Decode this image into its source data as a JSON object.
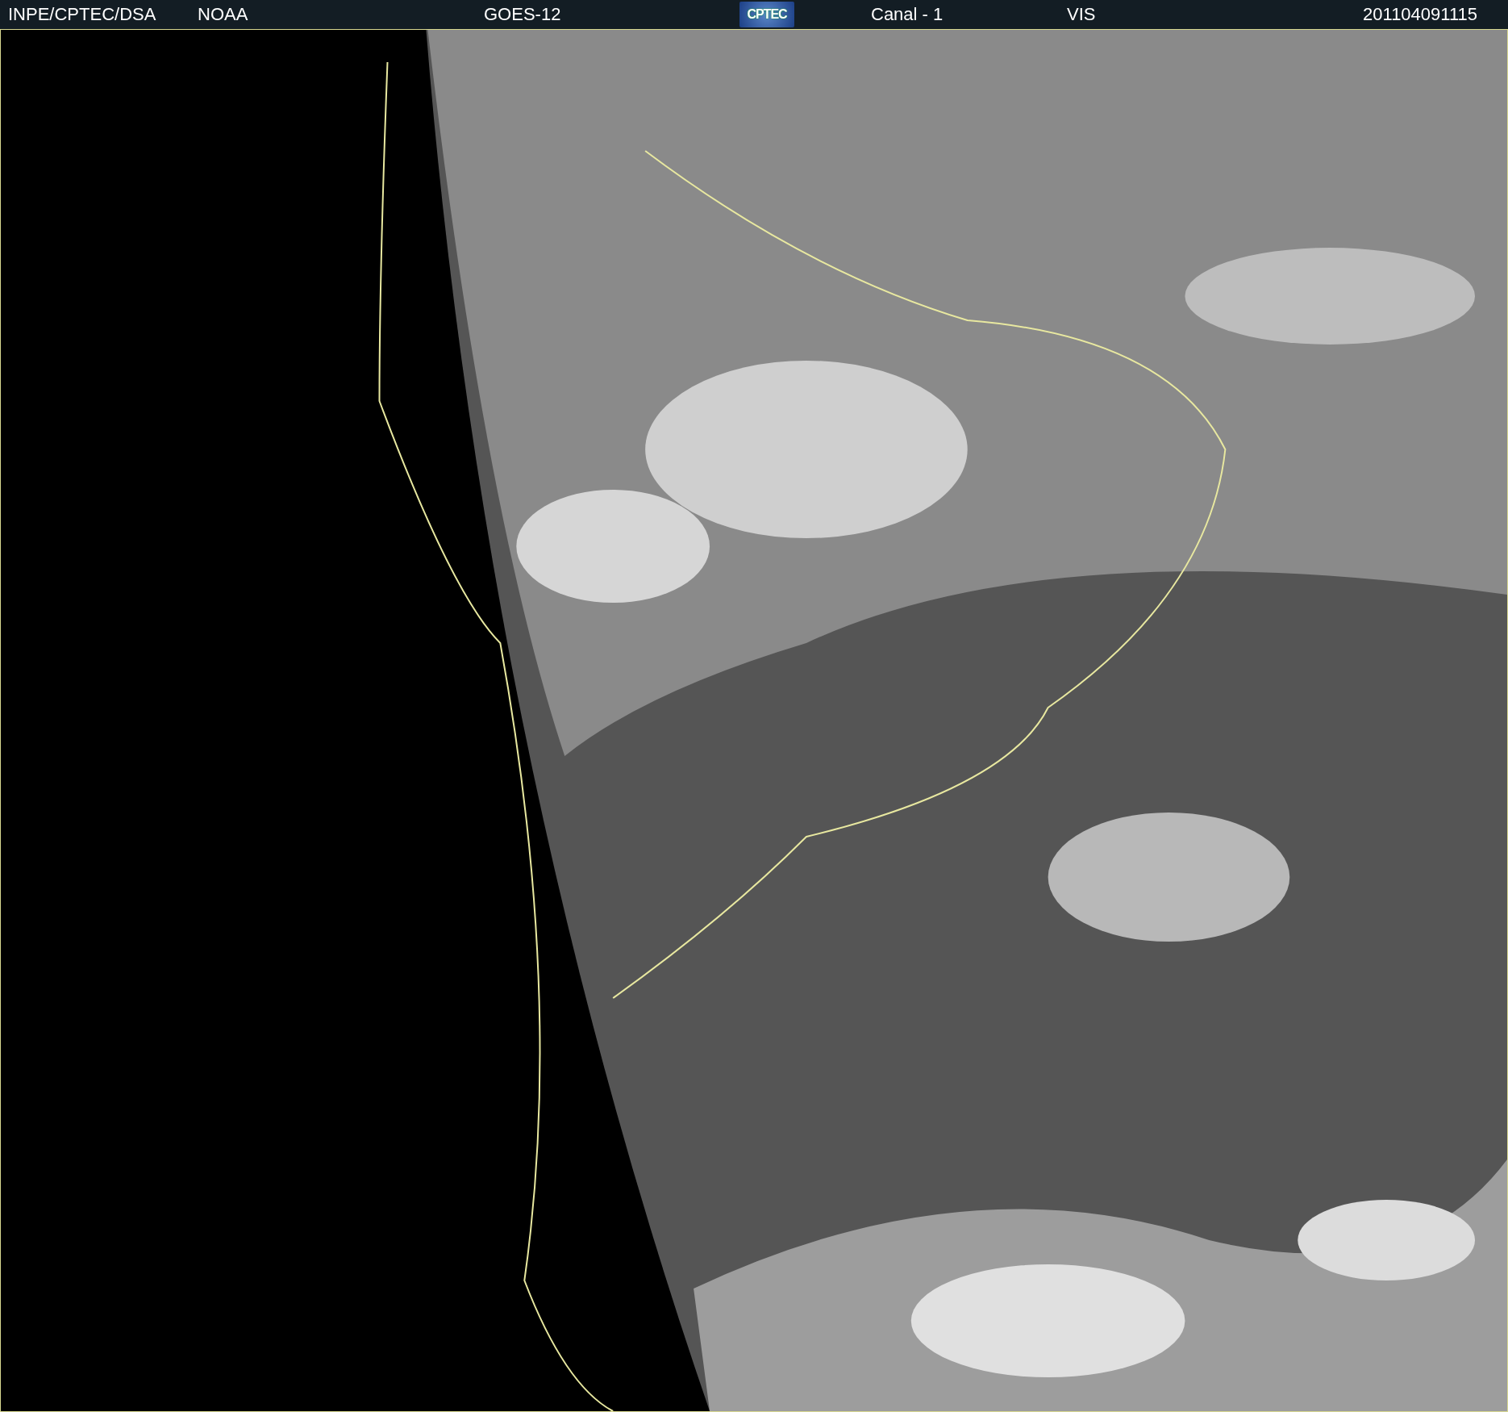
{
  "header": {
    "items": [
      {
        "kind": "text",
        "text": "INPE/CPTEC/DSA"
      },
      {
        "kind": "text",
        "text": "NOAA"
      },
      {
        "kind": "text",
        "text": "GOES-12"
      },
      {
        "kind": "logo",
        "text": "CPTEC"
      },
      {
        "kind": "text",
        "text": "Canal - 1"
      },
      {
        "kind": "text",
        "text": "VIS"
      },
      {
        "kind": "text",
        "text": "201104091115"
      }
    ]
  }
}
